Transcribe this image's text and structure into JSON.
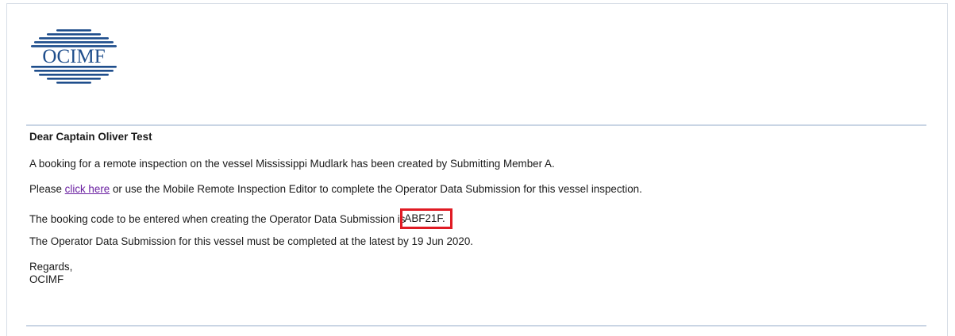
{
  "brand": {
    "logo_text": "OCIMF",
    "logo_color": "#1f4e8c"
  },
  "email": {
    "greeting": "Dear Captain Oliver Test",
    "line1": "A booking for a remote inspection on the vessel Mississippi Mudlark has been created by Submitting Member A.",
    "line2_prefix": "Please ",
    "line2_link": "click here",
    "line2_suffix": " or use the Mobile Remote Inspection Editor to complete the Operator Data Submission for this vessel inspection.",
    "line3_prefix": "The booking code to be entered when creating the Operator Data Submission is",
    "booking_code": "ABF21F.",
    "line4": "The Operator Data Submission for this vessel must be completed at the latest by 19 Jun 2020.",
    "signoff": "Regards,",
    "signature": "OCIMF"
  },
  "colors": {
    "link": "#6a1fa1",
    "highlight_border": "#e01b24",
    "divider": "#c9d5e4"
  }
}
